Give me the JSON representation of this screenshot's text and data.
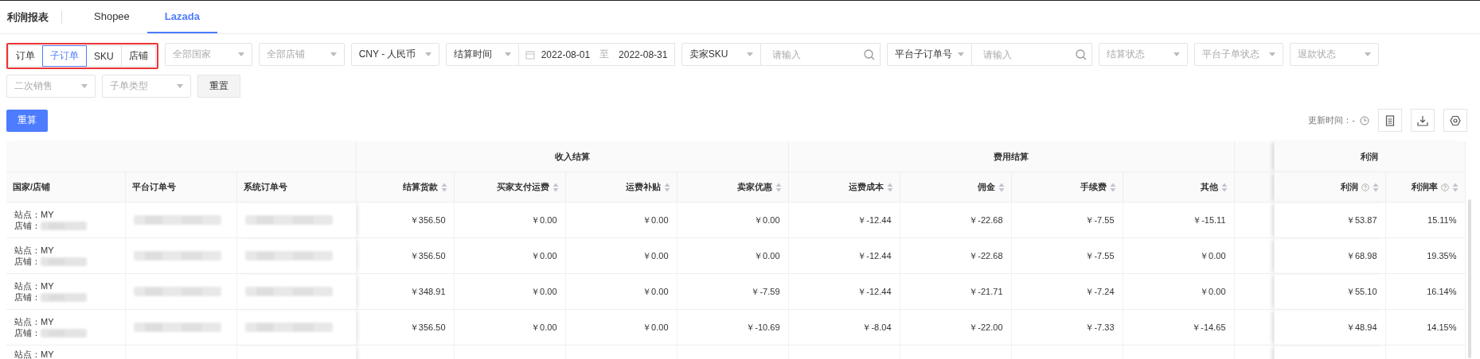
{
  "page_title": "利润报表",
  "tabs": [
    {
      "label": "Shopee",
      "selected": false
    },
    {
      "label": "Lazada",
      "selected": true
    }
  ],
  "segment": [
    {
      "label": "订单",
      "selected": false
    },
    {
      "label": "子订单",
      "selected": true
    },
    {
      "label": "SKU",
      "selected": false
    },
    {
      "label": "店铺",
      "selected": false
    }
  ],
  "filters": [
    {
      "kind": "select",
      "placeholder": "全部国家"
    },
    {
      "kind": "select",
      "placeholder": "全部店铺"
    },
    {
      "kind": "select",
      "value": "CNY - 人民币"
    },
    {
      "kind": "daterange",
      "type": "结算时间",
      "start": "2022-08-01",
      "separator": "至",
      "end": "2022-08-31"
    },
    {
      "kind": "search",
      "type": "卖家SKU",
      "placeholder": "请输入"
    },
    {
      "kind": "search",
      "type": "平台子订单号",
      "placeholder": "请输入"
    },
    {
      "kind": "select",
      "placeholder": "结算状态"
    },
    {
      "kind": "select",
      "placeholder": "平台子单状态"
    },
    {
      "kind": "select",
      "placeholder": "退款状态"
    },
    {
      "kind": "select",
      "placeholder": "二次销售"
    },
    {
      "kind": "select",
      "placeholder": "子单类型"
    },
    {
      "kind": "button",
      "label": "重置"
    }
  ],
  "recalc_button": "重算",
  "update_time": "更新时间：-",
  "table": {
    "groups": [
      {
        "label": "收入结算"
      },
      {
        "label": "费用结算"
      },
      {
        "label": "利润"
      }
    ],
    "columns": [
      {
        "label": "国家/店铺",
        "kind": "site"
      },
      {
        "label": "平台订单号",
        "kind": "redacted"
      },
      {
        "label": "系统订单号",
        "kind": "redacted"
      },
      {
        "label": "结算货款",
        "kind": "amount"
      },
      {
        "label": "买家支付运费",
        "kind": "amount"
      },
      {
        "label": "运费补贴",
        "kind": "amount"
      },
      {
        "label": "卖家优惠",
        "kind": "amount"
      },
      {
        "label": "运费成本",
        "kind": "amount"
      },
      {
        "label": "佣金",
        "kind": "amount"
      },
      {
        "label": "手续费",
        "kind": "amount"
      },
      {
        "label": "其他",
        "kind": "amount"
      },
      {
        "kind": "blank"
      },
      {
        "label": "利润",
        "kind": "metric"
      },
      {
        "label": "利润率",
        "kind": "metric"
      }
    ],
    "rows": [
      {
        "site": "站点：MY",
        "store_label": "店铺：",
        "cells": [
          "￥356.50",
          "￥0.00",
          "￥0.00",
          "￥0.00",
          "￥-12.44",
          "￥-22.68",
          "￥-7.55",
          "￥-15.11",
          "",
          "￥53.87",
          "15.11%"
        ]
      },
      {
        "site": "站点：MY",
        "store_label": "店铺：",
        "cells": [
          "￥356.50",
          "￥0.00",
          "￥0.00",
          "￥0.00",
          "￥-12.44",
          "￥-22.68",
          "￥-7.55",
          "￥0.00",
          "",
          "￥68.98",
          "19.35%"
        ]
      },
      {
        "site": "站点：MY",
        "store_label": "店铺：",
        "cells": [
          "￥348.91",
          "￥0.00",
          "￥0.00",
          "￥-7.59",
          "￥-12.44",
          "￥-21.71",
          "￥-7.24",
          "￥0.00",
          "",
          "￥55.10",
          "16.14%"
        ]
      },
      {
        "site": "站点：MY",
        "store_label": "店铺：",
        "cells": [
          "￥356.50",
          "￥0.00",
          "￥0.00",
          "￥-10.69",
          "￥-8.04",
          "￥-22.00",
          "￥-7.33",
          "￥-14.65",
          "",
          "￥48.94",
          "14.15%"
        ]
      },
      {
        "site": "站点：MY"
      }
    ]
  }
}
